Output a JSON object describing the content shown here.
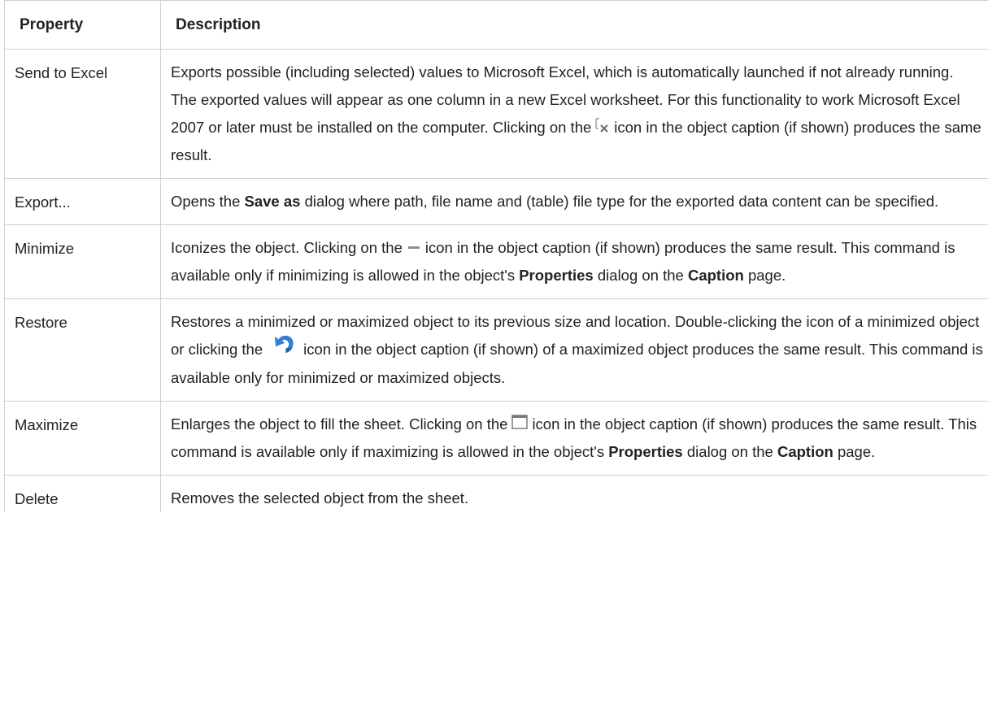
{
  "headers": {
    "property": "Property",
    "description": "Description"
  },
  "rows": [
    {
      "property": "Send to Excel",
      "d1": "Exports possible (including selected) values to Microsoft Excel, which is automatically launched if not already running. The exported values will appear as one column in a new Excel worksheet. For this functionality to work Microsoft Excel 2007 or later must be installed on the computer. Clicking on the",
      "icon": "send-to-excel-icon",
      "d2": "icon in the object caption (if shown) produces the same result."
    },
    {
      "property": "Export...",
      "d1": "Opens the",
      "b1": "Save as",
      "d2": "dialog where path, file name and (table) file type for the exported data content can be specified."
    },
    {
      "property": "Minimize",
      "d1": "Iconizes the object. Clicking on the",
      "icon": "minimize-icon",
      "d2": "icon in the object caption (if shown) produces the same result. This command is available only if minimizing is allowed in the object's",
      "b1": "Properties",
      "d3": "dialog on the",
      "b2": "Caption",
      "d4": "page."
    },
    {
      "property": "Restore",
      "d1": "Restores a minimized or maximized object to its previous size and location. Double-clicking the icon of a minimized object or clicking the",
      "icon": "restore-icon",
      "d2": "icon in the object caption (if shown) of a maximized object produces the same result. This command is available only for minimized or maximized objects."
    },
    {
      "property": "Maximize",
      "d1": "Enlarges the object to fill the sheet. Clicking on the",
      "icon": "maximize-icon",
      "d2": "icon in the object caption (if shown) produces the same result. This command is available only if maximizing is allowed in the object's",
      "b1": "Properties",
      "d3": "dialog on the",
      "b2": "Caption",
      "d4": "page."
    },
    {
      "property": "Delete",
      "d1": "Removes the selected object from the sheet."
    }
  ]
}
